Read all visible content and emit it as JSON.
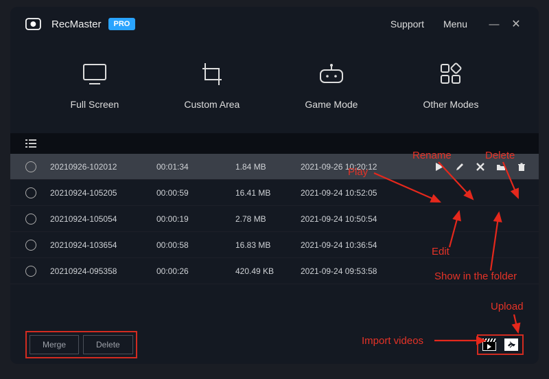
{
  "app": {
    "name": "RecMaster",
    "badge": "PRO"
  },
  "header": {
    "support": "Support",
    "menu": "Menu"
  },
  "modes": {
    "full_screen": "Full Screen",
    "custom_area": "Custom Area",
    "game_mode": "Game Mode",
    "other_modes": "Other Modes"
  },
  "recordings": [
    {
      "name": "20210926-102012",
      "duration": "00:01:34",
      "size": "1.84 MB",
      "date": "2021-09-26 10:20:12",
      "selected": true
    },
    {
      "name": "20210924-105205",
      "duration": "00:00:59",
      "size": "16.41 MB",
      "date": "2021-09-24 10:52:05",
      "selected": false
    },
    {
      "name": "20210924-105054",
      "duration": "00:00:19",
      "size": "2.78 MB",
      "date": "2021-09-24 10:50:54",
      "selected": false
    },
    {
      "name": "20210924-103654",
      "duration": "00:00:58",
      "size": "16.83 MB",
      "date": "2021-09-24 10:36:54",
      "selected": false
    },
    {
      "name": "20210924-095358",
      "duration": "00:00:26",
      "size": "420.49 KB",
      "date": "2021-09-24 09:53:58",
      "selected": false
    }
  ],
  "footer": {
    "merge": "Merge",
    "delete": "Delete"
  },
  "annotations": {
    "play": "Play",
    "rename": "Rename",
    "delete": "Delete",
    "edit": "Edit",
    "show_folder": "Show in the folder",
    "upload": "Upload",
    "import": "Import videos"
  }
}
